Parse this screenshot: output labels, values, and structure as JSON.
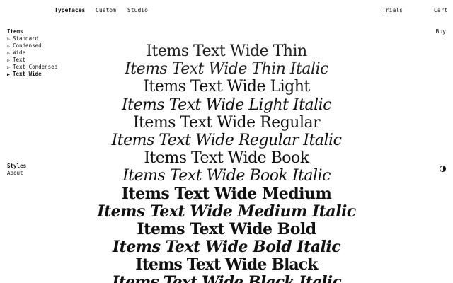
{
  "header": {
    "nav": [
      "Typefaces",
      "Custom",
      "Studio"
    ],
    "trials": "Trials",
    "cart": "Cart"
  },
  "buy": "Buy",
  "sidebar": {
    "items_heading": "Items",
    "items": [
      {
        "label": "Standard",
        "active": false
      },
      {
        "label": "Condensed",
        "active": false
      },
      {
        "label": "Wide",
        "active": false
      },
      {
        "label": "Text",
        "active": false
      },
      {
        "label": "Text Condensed",
        "active": false
      },
      {
        "label": "Text Wide",
        "active": true
      }
    ],
    "styles_heading": "Styles",
    "about": "About"
  },
  "icons": {
    "theme_toggle": "half-filled-circle-icon",
    "collapsed": "▷",
    "expanded": "▶"
  },
  "specimen": [
    {
      "text": "Items Text Wide Thin",
      "italic": false,
      "weight": "thin"
    },
    {
      "text": "Items Text Wide Thin Italic",
      "italic": true,
      "weight": "thin"
    },
    {
      "text": "Items Text Wide Light",
      "italic": false,
      "weight": "light"
    },
    {
      "text": "Items Text Wide Light Italic",
      "italic": true,
      "weight": "light"
    },
    {
      "text": "Items Text Wide Regular",
      "italic": false,
      "weight": "regular"
    },
    {
      "text": "Items Text Wide Regular Italic",
      "italic": true,
      "weight": "regular"
    },
    {
      "text": "Items Text Wide Book",
      "italic": false,
      "weight": "book"
    },
    {
      "text": "Items Text Wide Book Italic",
      "italic": true,
      "weight": "book"
    },
    {
      "text": "Items Text Wide Medium",
      "italic": false,
      "weight": "medium"
    },
    {
      "text": "Items Text Wide Medium Italic",
      "italic": true,
      "weight": "medium"
    },
    {
      "text": "Items Text Wide Bold",
      "italic": false,
      "weight": "bold"
    },
    {
      "text": "Items Text Wide Bold Italic",
      "italic": true,
      "weight": "bold"
    },
    {
      "text": "Items Text Wide Black",
      "italic": false,
      "weight": "black"
    },
    {
      "text": "Items Text Wide Black Italic",
      "italic": true,
      "weight": "black"
    }
  ]
}
